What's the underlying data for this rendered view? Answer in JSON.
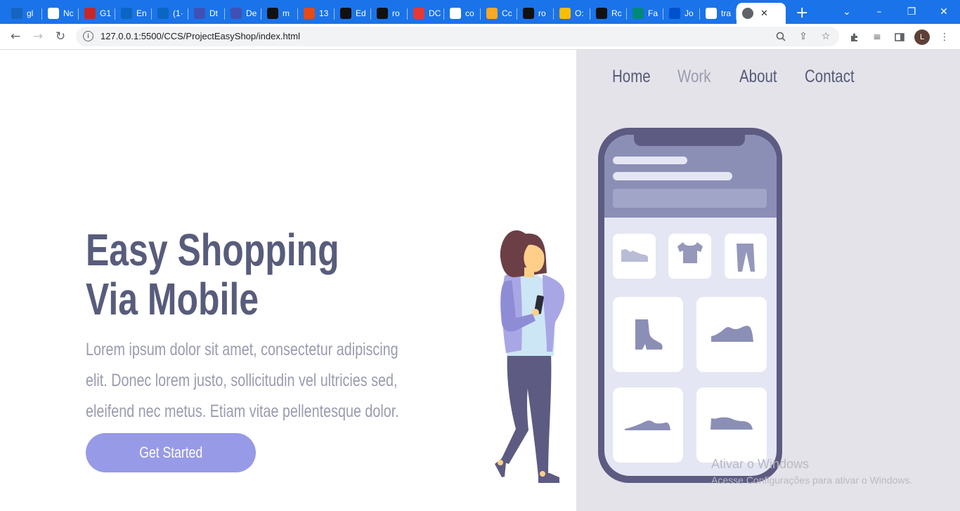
{
  "browser": {
    "tabs": [
      {
        "title": "gl",
        "icon": "g-icon",
        "color": "#1565c0"
      },
      {
        "title": "Nc",
        "icon": "rdx-icon",
        "color": "#ffffff"
      },
      {
        "title": "G1",
        "icon": "g1-icon",
        "color": "#c62828"
      },
      {
        "title": "En",
        "icon": "outlook-icon",
        "color": "#0a66c2"
      },
      {
        "title": "(1·",
        "icon": "linkedin-icon",
        "color": "#0a66c2"
      },
      {
        "title": "Dt",
        "icon": "discord-icon",
        "color": "#3f51b5"
      },
      {
        "title": "De",
        "icon": "discord-icon",
        "color": "#3f51b5"
      },
      {
        "title": "m",
        "icon": "github-icon",
        "color": "#111111"
      },
      {
        "title": "13",
        "icon": "figma-icon",
        "color": "#e64a19"
      },
      {
        "title": "Ed",
        "icon": "github-icon",
        "color": "#111111"
      },
      {
        "title": "ro",
        "icon": "github-icon",
        "color": "#111111"
      },
      {
        "title": "DC",
        "icon": "youtube-icon",
        "color": "#e53935"
      },
      {
        "title": "co",
        "icon": "google-icon",
        "color": "#ffffff"
      },
      {
        "title": "Cc",
        "icon": "cat-icon",
        "color": "#f9a825"
      },
      {
        "title": "ro",
        "icon": "github-icon",
        "color": "#111111"
      },
      {
        "title": "O:",
        "icon": "drive-icon",
        "color": "#fbbc04"
      },
      {
        "title": "Rc",
        "icon": "rocketseat-icon",
        "color": "#111111"
      },
      {
        "title": "Fa",
        "icon": "forms-icon",
        "color": "#00897b"
      },
      {
        "title": "Jo",
        "icon": "jira-icon",
        "color": "#0052cc"
      },
      {
        "title": "tra",
        "icon": "google-icon",
        "color": "#ffffff"
      }
    ],
    "active_tab": {
      "icon": "globe-icon",
      "close": "✕"
    },
    "new_tab": "+",
    "url": "127.0.0.1:5500/CCS/ProjectEasyShop/index.html",
    "profile_initial": "L"
  },
  "nav": {
    "home": "Home",
    "work": "Work",
    "about": "About",
    "contact": "Contact"
  },
  "hero": {
    "title_line1": "Easy Shopping",
    "title_line2": "Via Mobile",
    "text_line1": "Lorem ipsum dolor sit amet, consectetur adipiscing",
    "text_line2": "elit. Donec lorem justo, sollicitudin vel ultricies sed,",
    "text_line3": "eleifend nec metus. Etiam vitae pellentesque dolor.",
    "cta": "Get Started"
  },
  "watermark": {
    "line1": "Ativar o Windows",
    "line2": "Acesse Configurações para ativar o Windows."
  },
  "colors": {
    "accent": "#979ae6",
    "heading": "#585c7c",
    "muted": "#9a9bb0",
    "panel": "#e4e3e9",
    "phone": "#5d5b82"
  }
}
